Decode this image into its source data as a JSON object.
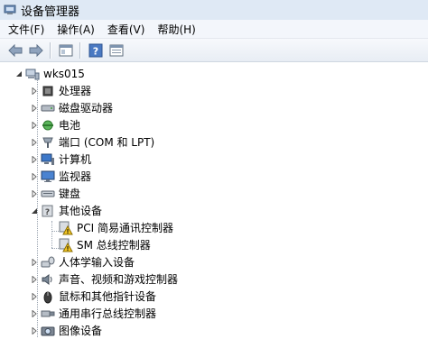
{
  "window": {
    "title": "设备管理器"
  },
  "menu": [
    "文件(F)",
    "操作(A)",
    "查看(V)",
    "帮助(H)"
  ],
  "toolbar": {
    "buttons": [
      "back-icon",
      "forward-icon",
      "console-tree-icon",
      "help-icon",
      "properties-icon"
    ]
  },
  "tree": {
    "root": "wks015",
    "categories": [
      "处理器",
      "磁盘驱动器",
      "电池",
      "端口 (COM 和 LPT)",
      "计算机",
      "监视器",
      "键盘",
      "其他设备",
      "人体学输入设备",
      "声音、视频和游戏控制器",
      "鼠标和其他指针设备",
      "通用串行总线控制器",
      "图像设备"
    ],
    "other_devices": [
      "PCI 简易通讯控制器",
      "SM 总线控制器"
    ]
  }
}
